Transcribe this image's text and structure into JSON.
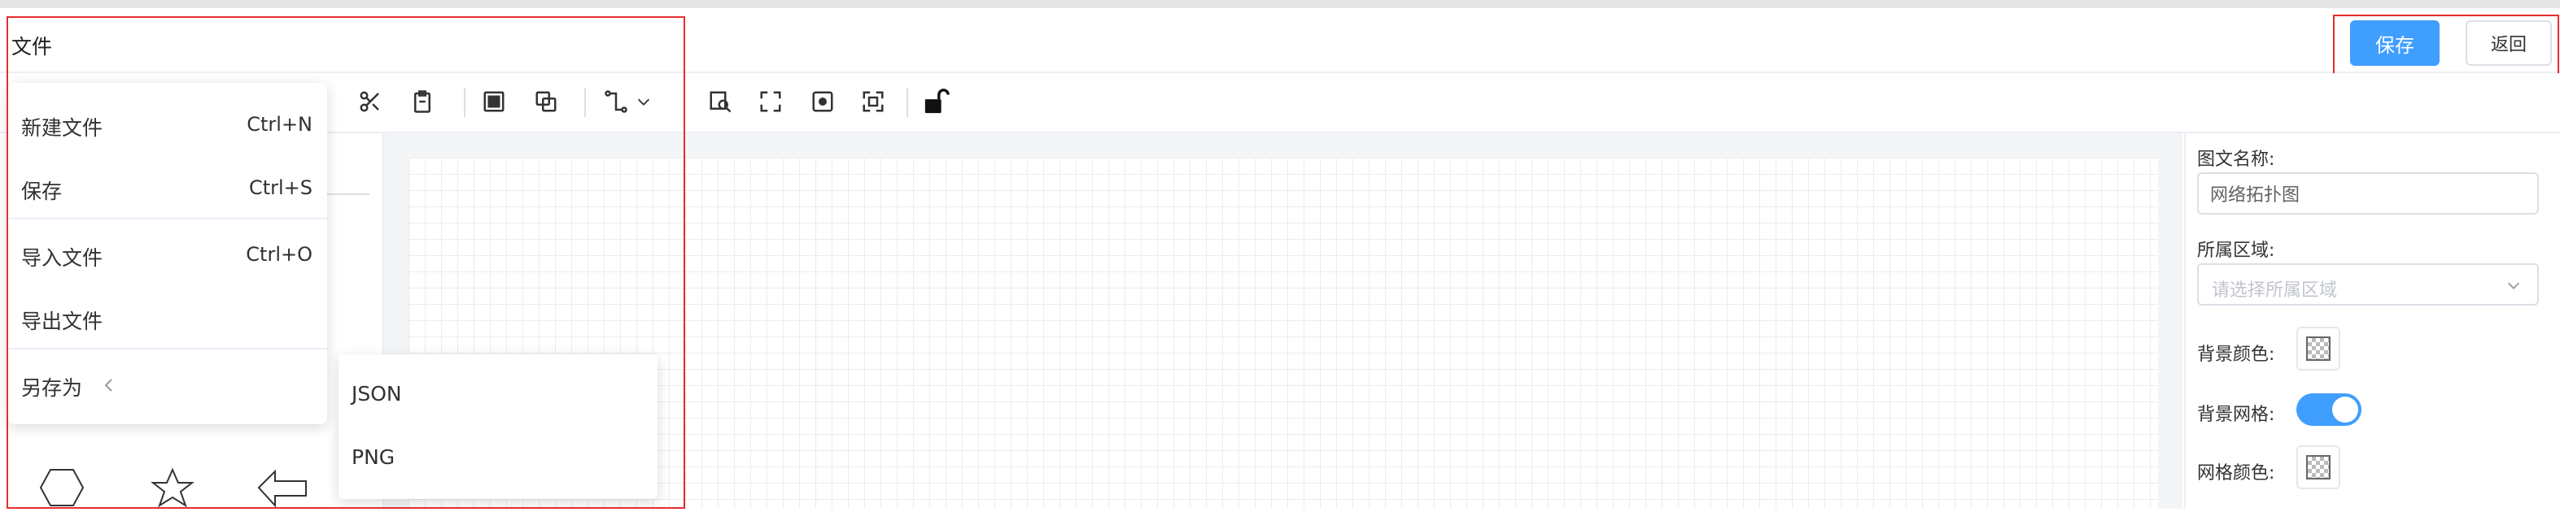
{
  "menu": {
    "file_label": "文件"
  },
  "header": {
    "save_label": "保存",
    "back_label": "返回"
  },
  "file_dropdown": {
    "new_file": {
      "label": "新建文件",
      "shortcut": "Ctrl+N"
    },
    "save": {
      "label": "保存",
      "shortcut": "Ctrl+S"
    },
    "import_file": {
      "label": "导入文件",
      "shortcut": "Ctrl+O"
    },
    "export_file": {
      "label": "导出文件"
    },
    "save_as": {
      "label": "另存为"
    }
  },
  "save_as_submenu": {
    "items": [
      "JSON",
      "PNG"
    ]
  },
  "toolbar": {
    "icons": [
      "cut-icon",
      "paste-icon",
      "bring-front-icon",
      "send-back-icon",
      "connector-icon",
      "chevron-down-icon",
      "zoom-search-icon",
      "fullscreen-icon",
      "fit-icon",
      "expand-icon",
      "unlock-icon"
    ]
  },
  "properties": {
    "name_label": "图文名称:",
    "name_value": "网络拓扑图",
    "region_label": "所属区域:",
    "region_placeholder": "请选择所属区域",
    "bg_color_label": "背景颜色:",
    "bg_grid_label": "背景网格:",
    "bg_grid_enabled": true,
    "grid_color_label": "网格颜色:"
  },
  "colors": {
    "accent": "#409eff",
    "highlight_box": "#e52d2d"
  }
}
